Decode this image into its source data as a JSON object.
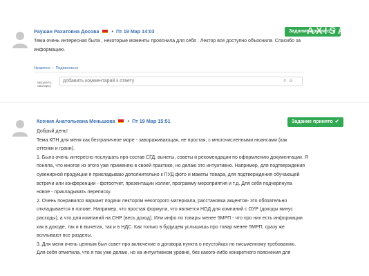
{
  "comments": [
    {
      "author": "Раушан Рахатовна Досова",
      "date": "Пт 19 Мар 14:03",
      "badge": "Задание принято",
      "badge_watermark": "АXISA",
      "text": [
        "Тема очень интересная была , некоторые моменты прояснила для себя . Лектор все доступно объяснила. Спасибо за",
        "информацию."
      ],
      "actions": {
        "like": "Нравится",
        "subscribe": "Подписаться"
      },
      "reply": {
        "avatar_text": "загрузить аватарку",
        "placeholder": "добавить комментарий к ответу"
      }
    },
    {
      "author": "Ксения Анатольевна Меньшова",
      "date": "Пт 19 Мар 15:51",
      "badge": "Задание принято",
      "text": [
        "Добрый день!",
        "Тема КПН для меня как безграничное море - завораживающая, не простая, с многочисленными нюансами (как",
        "оттенки и грани).",
        "1. Было очень интересно послушать про состав СГД, вычеты, советы и рекомендации по оформлению документации. Я",
        "поняла, что многое из этого уже применяю в своей практике, но делаю это интуитивно. Например, для подтверждения",
        "сувенирной продукции я прикладываю дополнительно к ПУД фото и макеты товара, для подтверждения обучающей",
        "встречи или конференции - фотоотчет, презентации коллег, программу мероприятия и т.д. Для себя подчерпнула",
        "новое - прикладывать переписку.",
        "2. Очень понравился вариант подачи лектором некоторого материала, расстановка акцентов- это обязательно",
        "откладывается в голове. Например, что простая формула, что является НОД для компаний с ОУР (доходы минус",
        "расходы), а что для компаний на СНР (весь доход). Или инфо по товары менее 5МРП - что про них есть информации",
        "как в доходе, так и в вычетах, так и в НДС. Как только в будущем услышишь про товар менее 5МРП, сразу же",
        "всплывают все разделы.",
        "3. Для меня очень ценным был совет про включение в договора пункта о неустойках по письменному требованию.",
        "Для себя отметила, что я так уже делаю, но на интуитивном уровне, без какого-либо конкретного пояснения для"
      ]
    }
  ],
  "colors": {
    "link": "#3a6fb0",
    "badge_bg": "#32a852",
    "flag": "#d7261f"
  },
  "icons": [
    "attach-icon",
    "smile-icon",
    "check-icon",
    "user-placeholder-icon"
  ]
}
